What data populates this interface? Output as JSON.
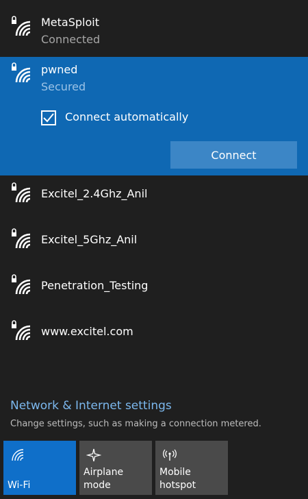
{
  "networks": [
    {
      "name": "MetaSploit",
      "status": "Connected"
    },
    {
      "name": "pwned",
      "status": "Secured",
      "auto_connect_label": "Connect automatically",
      "connect_button": "Connect"
    },
    {
      "name": "Excitel_2.4Ghz_Anil"
    },
    {
      "name": "Excitel_5Ghz_Anil"
    },
    {
      "name": "Penetration_Testing"
    },
    {
      "name": "www.excitel.com"
    }
  ],
  "settings": {
    "link": "Network & Internet settings",
    "description": "Change settings, such as making a connection metered."
  },
  "quick_actions": [
    {
      "label": "Wi-Fi",
      "icon": "wifi-icon",
      "active": true
    },
    {
      "label": "Airplane mode",
      "icon": "airplane-icon",
      "active": false
    },
    {
      "label_line1": "Mobile",
      "label_line2": "hotspot",
      "icon": "hotspot-icon",
      "active": false
    }
  ],
  "colors": {
    "background": "#1f1f1f",
    "selected": "#0f68b3",
    "accent": "#0f6fc9",
    "link": "#7cb8ee"
  }
}
